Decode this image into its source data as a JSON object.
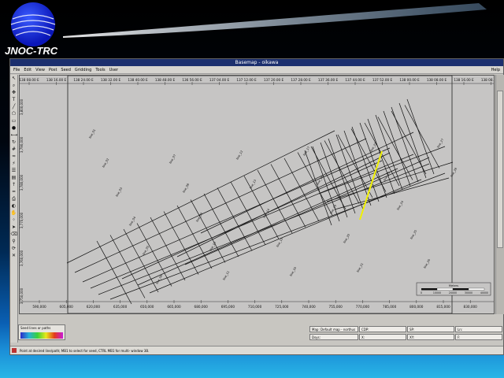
{
  "slide": {
    "title": "JNOC-TRC",
    "colors": {
      "background_top": "#000000",
      "background_bottom": "#29b6e6",
      "logo_blue": "#1630e0"
    }
  },
  "window": {
    "title": "Basemap - oikawa",
    "menu": [
      "File",
      "Edit",
      "View",
      "Post",
      "Seed",
      "Gridding",
      "Tools",
      "User"
    ],
    "help": "Help"
  },
  "toolbar": {
    "icons": [
      "pointer-icon",
      "zoom-icon",
      "pan-icon",
      "text-icon",
      "line-icon",
      "polygon-icon",
      "select-icon",
      "well-icon",
      "measure-icon",
      "rotate-icon",
      "grid-icon",
      "contour-icon",
      "fault-icon",
      "layer-icon",
      "legend-icon",
      "north-icon",
      "scale-icon",
      "print-icon",
      "color-icon",
      "hand-icon",
      "dots-icon",
      "arrow-icon",
      "eraser-icon",
      "pin-icon",
      "refresh-icon",
      "close-icon"
    ]
  },
  "map": {
    "lon_labels": [
      "138 08.00 E",
      "138 16.00 E",
      "138 24.00 E",
      "138 32.00 E",
      "138 40.00 E",
      "138 48.00 E",
      "136 56.00 E",
      "137 04.00 E",
      "137 12.00 E",
      "137 20.00 E",
      "137 28.00 E",
      "137 36.00 E",
      "137 44.00 E",
      "137 52.00 E",
      "138 00.00 E",
      "138 08.00 E",
      "138 16.00 E",
      "138 08.00 E"
    ],
    "easting_labels": [
      "590,000",
      "605,000",
      "620,000",
      "635,000",
      "650,000",
      "665,000",
      "680,000",
      "695,000",
      "710,000",
      "725,000",
      "740,000",
      "755,000",
      "770,000",
      "785,000",
      "800,000",
      "815,000",
      "830,000"
    ],
    "northing_labels": [
      "3,800,000",
      "3,790,000",
      "3,780,000",
      "3,770,000",
      "3,760,000",
      "3,750,000"
    ],
    "line_labels": [
      "line_01",
      "line_02",
      "line_03",
      "line_04",
      "line_05",
      "line_06",
      "line_07",
      "line_08",
      "line_09",
      "line_10",
      "line_11",
      "line_12",
      "line_13",
      "line_14",
      "line_15",
      "line_16",
      "line_17",
      "line_18",
      "line_19",
      "line_20",
      "line_21",
      "line_22",
      "line_23",
      "line_24",
      "line_25",
      "line_26",
      "line_27",
      "line_28"
    ],
    "highlight_color": "#f0f000",
    "scale_bar": {
      "title": "Meters",
      "ticks": [
        "0",
        "10000",
        "20000",
        "30000",
        "40000"
      ]
    }
  },
  "nav_buttons": [
    "◀",
    "▶",
    "⊕",
    "⊖",
    "⊙"
  ],
  "colorbar": {
    "label": "Seed lines or paths"
  },
  "info_fields": {
    "map": "Map: Default map - northus",
    "cdp": "CDP:",
    "sp": "SP:",
    "ln": "Ln:",
    "dsys": "Dsys:",
    "x": "X:",
    "xy": "XY:",
    "f": "F:"
  },
  "status": {
    "text": "Point at desired line/path; MB1 to select for seed, CTRL MB1 for multi- window 3B."
  }
}
